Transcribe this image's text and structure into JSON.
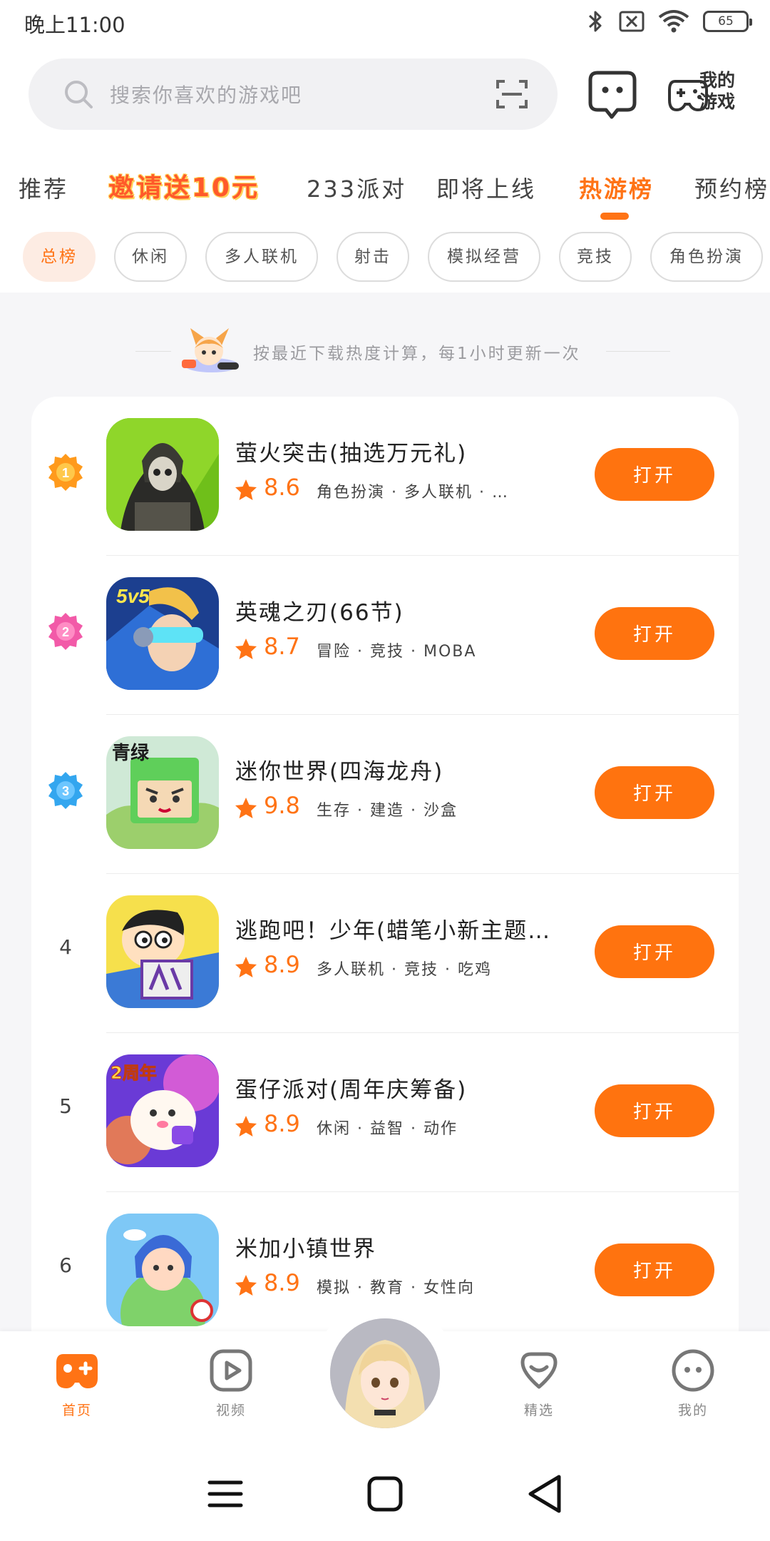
{
  "status": {
    "time": "晚上11:00",
    "battery": "65"
  },
  "search": {
    "placeholder": "搜索你喜欢的游戏吧"
  },
  "my_games": {
    "line1": "我的",
    "line2": "游戏"
  },
  "tabs": [
    "推荐",
    "邀请送10元",
    "233派对",
    "即将上线",
    "热游榜",
    "预约榜"
  ],
  "active_tab": "热游榜",
  "chips": [
    "总榜",
    "休闲",
    "多人联机",
    "射击",
    "模拟经营",
    "竞技",
    "角色扮演"
  ],
  "active_chip": "总榜",
  "notice": "按最近下载热度计算，每1小时更新一次",
  "games": [
    {
      "rank": "1",
      "name": "萤火突击(抽选万元礼)",
      "score": "8.6",
      "tags": "角色扮演 · 多人联机 · …",
      "action": "打开"
    },
    {
      "rank": "2",
      "name": "英魂之刃(66节)",
      "score": "8.7",
      "tags": "冒险 · 竞技 · MOBA",
      "action": "打开"
    },
    {
      "rank": "3",
      "name": "迷你世界(四海龙舟)",
      "score": "9.8",
      "tags": "生存 · 建造 · 沙盒",
      "action": "打开"
    },
    {
      "rank": "4",
      "name": "逃跑吧！少年(蜡笔小新主题…",
      "score": "8.9",
      "tags": "多人联机 · 竞技 · 吃鸡",
      "action": "打开"
    },
    {
      "rank": "5",
      "name": "蛋仔派对(周年庆筹备)",
      "score": "8.9",
      "tags": "休闲 · 益智 · 动作",
      "action": "打开"
    },
    {
      "rank": "6",
      "name": "米加小镇世界",
      "score": "8.9",
      "tags": "模拟 · 教育 · 女性向",
      "action": "打开"
    }
  ],
  "icon_texts": {
    "g2": "5v5",
    "g3": "青绿",
    "g5": "2周年"
  },
  "bottom_nav": {
    "home": "首页",
    "video": "视频",
    "featured": "精选",
    "mine": "我的"
  },
  "colors": {
    "accent": "#ff7315",
    "button": "#ff730f"
  }
}
